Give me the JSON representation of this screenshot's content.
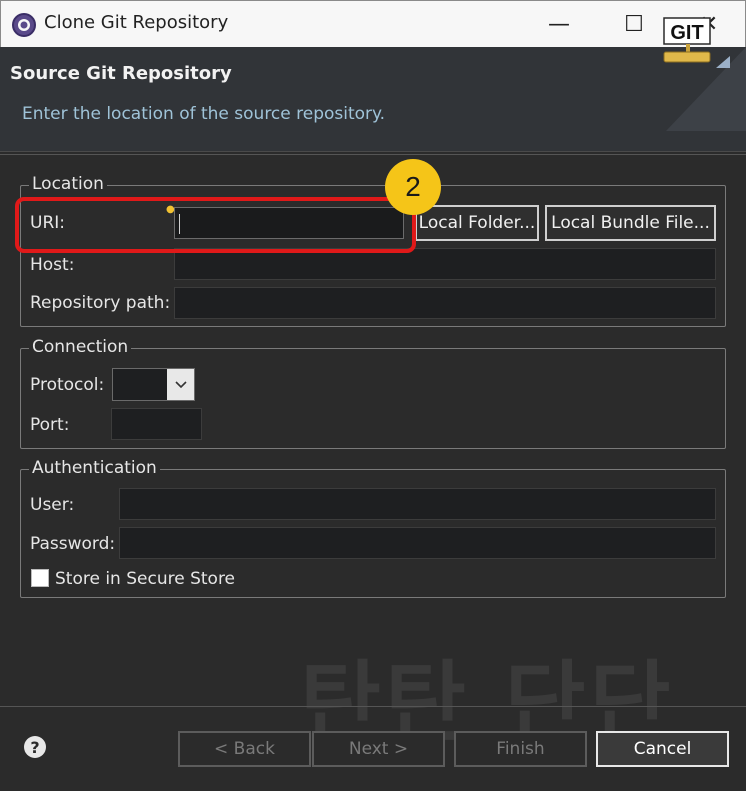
{
  "window": {
    "title": "Clone Git Repository",
    "minimize_glyph": "—",
    "maximize_glyph": "☐",
    "close_glyph": "✕"
  },
  "banner": {
    "title": "Source Git Repository",
    "description": "Enter the location of the source repository.",
    "logo_text": "GIT"
  },
  "location": {
    "legend": "Location",
    "uri_label": "URI:",
    "uri_value": "",
    "host_label": "Host:",
    "host_value": "",
    "repo_path_label": "Repository path:",
    "repo_path_value": "",
    "local_folder_button": "Local Folder...",
    "local_bundle_button": "Local Bundle File..."
  },
  "connection": {
    "legend": "Connection",
    "protocol_label": "Protocol:",
    "protocol_value": "",
    "port_label": "Port:",
    "port_value": ""
  },
  "authentication": {
    "legend": "Authentication",
    "user_label": "User:",
    "user_value": "",
    "password_label": "Password:",
    "password_value": "",
    "secure_store_label": "Store in Secure Store",
    "secure_store_checked": false
  },
  "annotation": {
    "step_number": "2"
  },
  "watermark": "탄탄 단단",
  "footer": {
    "help_glyph": "?",
    "back_label": "< Back",
    "next_label": "Next >",
    "finish_label": "Finish",
    "cancel_label": "Cancel"
  },
  "colors": {
    "highlight": "#e01919",
    "badge": "#f5c518",
    "banner_desc": "#9fc3d8"
  }
}
